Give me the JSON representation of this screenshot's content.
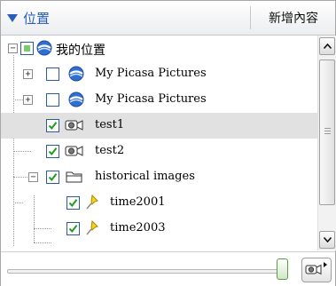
{
  "header": {
    "title": "位置",
    "add_content_label": "新增內容"
  },
  "tree": {
    "items": [
      {
        "label": "我的位置",
        "icon": "globe-icon",
        "check": "partial",
        "expander": "minus"
      },
      {
        "label": "My Picasa Pictures",
        "icon": "globe-icon",
        "check": "unchecked",
        "expander": "plus"
      },
      {
        "label": "My Picasa Pictures",
        "icon": "globe-icon",
        "check": "unchecked",
        "expander": "plus"
      },
      {
        "label": "test1",
        "icon": "tour-camera-icon",
        "check": "checked",
        "selected": true
      },
      {
        "label": "test2",
        "icon": "tour-camera-icon",
        "check": "checked"
      },
      {
        "label": "historical images",
        "icon": "folder-icon",
        "check": "checked",
        "expander": "minus"
      },
      {
        "label": "time2001",
        "icon": "pushpin-icon",
        "check": "checked"
      },
      {
        "label": "time2003",
        "icon": "pushpin-icon",
        "check": "checked"
      }
    ]
  },
  "slider": {
    "value_fraction": 1.0
  },
  "colors": {
    "header_title": "#2a5db8",
    "checkbox_border": "#2c5aa0",
    "checkmark": "#1f9a1f",
    "partial_fill": "#7acb6a",
    "selected_row": "#e1e1e1"
  }
}
